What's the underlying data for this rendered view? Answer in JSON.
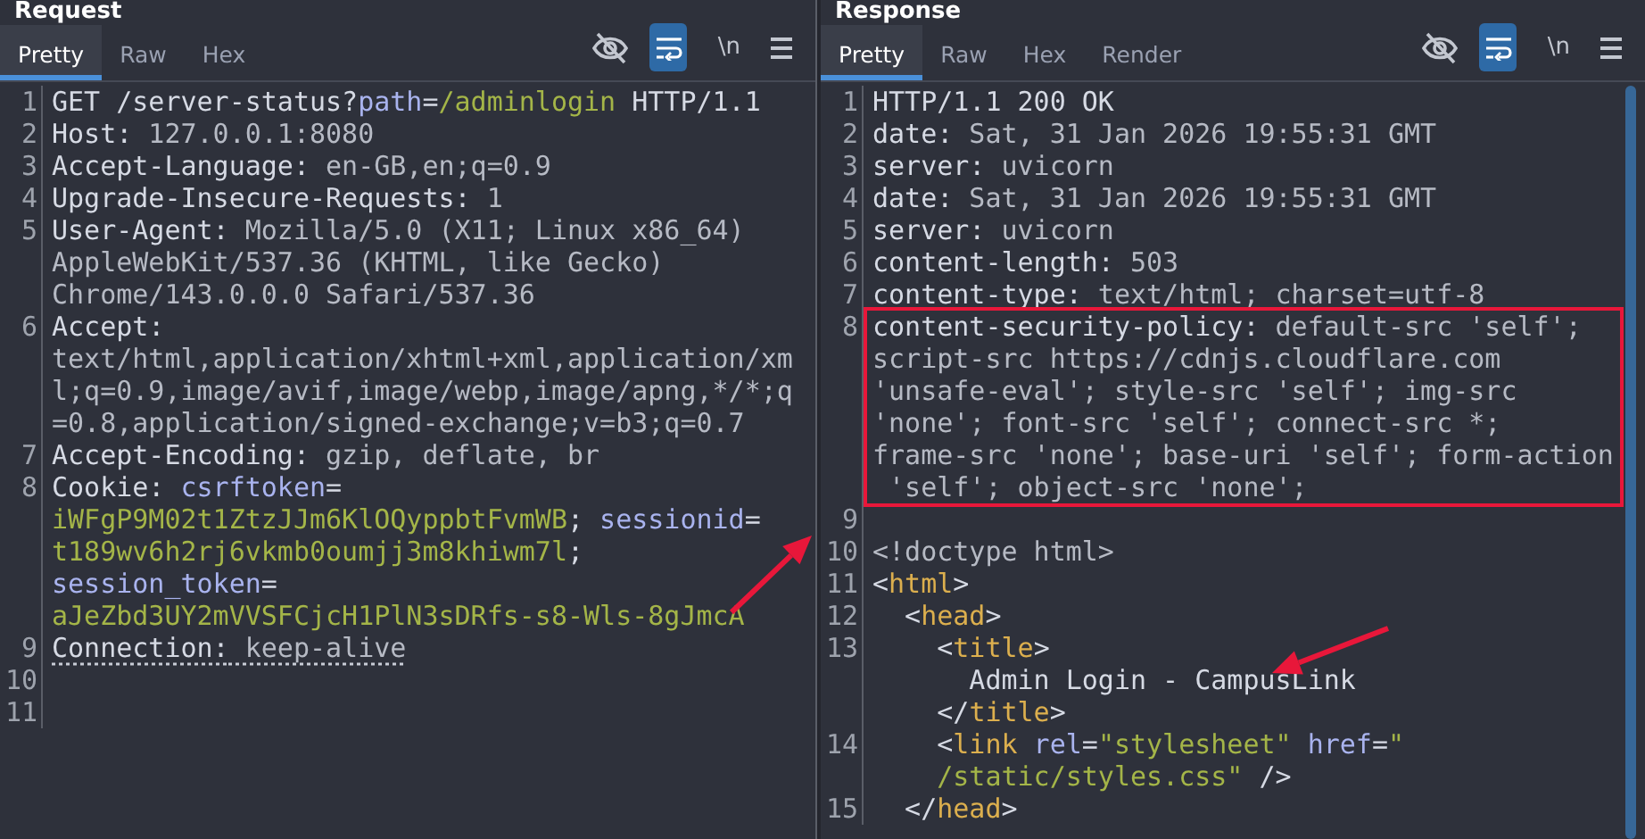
{
  "panels": [
    {
      "title": "Request",
      "tabs": [
        {
          "label": "Pretty",
          "selected": true
        },
        {
          "label": "Raw",
          "selected": false
        },
        {
          "label": "Hex",
          "selected": false
        }
      ],
      "toolbar": [
        {
          "kind": "hide"
        },
        {
          "kind": "wrap",
          "selected": true
        },
        {
          "kind": "newline",
          "label": "\\n"
        },
        {
          "kind": "menu"
        }
      ],
      "lines": [
        {
          "number": "1",
          "rows": [
            {
              "spans": [
                {
                  "kind": "name",
                  "text": "GET /server-status?"
                },
                {
                  "kind": "param",
                  "text": "path"
                },
                {
                  "kind": "name",
                  "text": "="
                },
                {
                  "kind": "green",
                  "text": "/adminlogin"
                },
                {
                  "kind": "name",
                  "text": " HTTP/1.1"
                }
              ]
            }
          ]
        },
        {
          "number": "2",
          "rows": [
            {
              "spans": [
                {
                  "kind": "name",
                  "text": "Host:"
                },
                {
                  "kind": "value",
                  "text": " 127.0.0.1:8080"
                }
              ]
            }
          ]
        },
        {
          "number": "3",
          "rows": [
            {
              "spans": [
                {
                  "kind": "name",
                  "text": "Accept-Language:"
                },
                {
                  "kind": "value",
                  "text": " en-GB,en;q=0.9"
                }
              ]
            }
          ]
        },
        {
          "number": "4",
          "rows": [
            {
              "spans": [
                {
                  "kind": "name",
                  "text": "Upgrade-Insecure-Requests:"
                },
                {
                  "kind": "value",
                  "text": " 1"
                }
              ]
            }
          ]
        },
        {
          "number": "5",
          "rows": [
            {
              "spans": [
                {
                  "kind": "name",
                  "text": "User-Agent:"
                },
                {
                  "kind": "value",
                  "text": " Mozilla/5.0 (X11; Linux x86_64)"
                }
              ]
            },
            {
              "spans": [
                {
                  "kind": "value",
                  "text": "AppleWebKit/537.36 (KHTML, like Gecko)"
                }
              ]
            },
            {
              "spans": [
                {
                  "kind": "value",
                  "text": "Chrome/143.0.0.0 Safari/537.36"
                }
              ]
            }
          ]
        },
        {
          "number": "6",
          "rows": [
            {
              "spans": [
                {
                  "kind": "name",
                  "text": "Accept:"
                }
              ]
            },
            {
              "spans": [
                {
                  "kind": "value",
                  "text": "text/html,application/xhtml+xml,application/xm"
                }
              ]
            },
            {
              "spans": [
                {
                  "kind": "value",
                  "text": "l;q=0.9,image/avif,image/webp,image/apng,*/*;q"
                }
              ]
            },
            {
              "spans": [
                {
                  "kind": "value",
                  "text": "=0.8,application/signed-exchange;v=b3;q=0.7"
                }
              ]
            }
          ]
        },
        {
          "number": "7",
          "rows": [
            {
              "spans": [
                {
                  "kind": "name",
                  "text": "Accept-Encoding:"
                },
                {
                  "kind": "value",
                  "text": " gzip, deflate, br"
                }
              ]
            }
          ]
        },
        {
          "number": "8",
          "rows": [
            {
              "spans": [
                {
                  "kind": "name",
                  "text": "Cookie: "
                },
                {
                  "kind": "param",
                  "text": "csrftoken"
                },
                {
                  "kind": "name",
                  "text": "="
                }
              ]
            },
            {
              "spans": [
                {
                  "kind": "green",
                  "text": "iWFgP9M02t1ZtzJJm6KlOQyppbtFvmWB"
                },
                {
                  "kind": "name",
                  "text": "; "
                },
                {
                  "kind": "param",
                  "text": "sessionid"
                },
                {
                  "kind": "name",
                  "text": "="
                }
              ]
            },
            {
              "spans": [
                {
                  "kind": "green",
                  "text": "t189wv6h2rj6vkmb0oumjj3m8khiwm7l"
                },
                {
                  "kind": "name",
                  "text": ";"
                }
              ]
            },
            {
              "spans": [
                {
                  "kind": "param",
                  "text": "session_token"
                },
                {
                  "kind": "name",
                  "text": "="
                }
              ]
            },
            {
              "spans": [
                {
                  "kind": "green",
                  "text": "aJeZbd3UY2mVVSFCjcH1PlN3sDRfs-s8-Wls-8gJmcA"
                }
              ]
            }
          ]
        },
        {
          "number": "9",
          "underlined": true,
          "rows": [
            {
              "spans": [
                {
                  "kind": "name",
                  "text": "Connection:"
                },
                {
                  "kind": "value",
                  "text": " keep-alive"
                }
              ]
            }
          ]
        },
        {
          "number": "10",
          "rows": [
            {}
          ]
        },
        {
          "number": "11",
          "rows": [
            {}
          ]
        }
      ]
    },
    {
      "title": "Response",
      "tabs": [
        {
          "label": "Pretty",
          "selected": true
        },
        {
          "label": "Raw",
          "selected": false
        },
        {
          "label": "Hex",
          "selected": false
        },
        {
          "label": "Render",
          "selected": false
        }
      ],
      "toolbar": [
        {
          "kind": "hide"
        },
        {
          "kind": "wrap",
          "selected": true
        },
        {
          "kind": "newline",
          "label": "\\n"
        },
        {
          "kind": "menu"
        }
      ],
      "lines": [
        {
          "number": "1",
          "rows": [
            {
              "spans": [
                {
                  "kind": "name",
                  "text": "HTTP/1.1 200 OK"
                }
              ]
            }
          ]
        },
        {
          "number": "2",
          "rows": [
            {
              "spans": [
                {
                  "kind": "name",
                  "text": "date:"
                },
                {
                  "kind": "value",
                  "text": " Sat, 31 Jan 2026 19:55:31 GMT"
                }
              ]
            }
          ]
        },
        {
          "number": "3",
          "rows": [
            {
              "spans": [
                {
                  "kind": "name",
                  "text": "server:"
                },
                {
                  "kind": "value",
                  "text": " uvicorn"
                }
              ]
            }
          ]
        },
        {
          "number": "4",
          "rows": [
            {
              "spans": [
                {
                  "kind": "name",
                  "text": "date:"
                },
                {
                  "kind": "value",
                  "text": " Sat, 31 Jan 2026 19:55:31 GMT"
                }
              ]
            }
          ]
        },
        {
          "number": "5",
          "rows": [
            {
              "spans": [
                {
                  "kind": "name",
                  "text": "server:"
                },
                {
                  "kind": "value",
                  "text": " uvicorn"
                }
              ]
            }
          ]
        },
        {
          "number": "6",
          "rows": [
            {
              "spans": [
                {
                  "kind": "name",
                  "text": "content-length:"
                },
                {
                  "kind": "value",
                  "text": " 503"
                }
              ]
            }
          ]
        },
        {
          "number": "7",
          "rows": [
            {
              "spans": [
                {
                  "kind": "name",
                  "text": "content-type:"
                },
                {
                  "kind": "value",
                  "text": " text/html; charset=utf-8"
                }
              ]
            }
          ]
        },
        {
          "number": "8",
          "rows": [
            {
              "spans": [
                {
                  "kind": "name",
                  "text": "content-security-policy:"
                },
                {
                  "kind": "value",
                  "text": " default-src 'self';"
                }
              ]
            },
            {
              "spans": [
                {
                  "kind": "value",
                  "text": "script-src https://cdnjs.cloudflare.com"
                }
              ]
            },
            {
              "spans": [
                {
                  "kind": "value",
                  "text": "'unsafe-eval'; style-src 'self'; img-src"
                }
              ]
            },
            {
              "spans": [
                {
                  "kind": "value",
                  "text": "'none'; font-src 'self'; connect-src *;"
                }
              ]
            },
            {
              "spans": [
                {
                  "kind": "value",
                  "text": "frame-src 'none'; base-uri 'self'; form-action"
                }
              ]
            },
            {
              "spans": [
                {
                  "kind": "value",
                  "text": " 'self'; object-src 'none';"
                }
              ]
            }
          ]
        },
        {
          "number": "9",
          "rows": [
            {}
          ]
        },
        {
          "number": "10",
          "rows": [
            {
              "spans": [
                {
                  "kind": "value",
                  "text": "<!doctype html>"
                }
              ]
            }
          ]
        },
        {
          "number": "11",
          "rows": [
            {
              "spans": [
                {
                  "kind": "name",
                  "text": "<"
                },
                {
                  "kind": "tag",
                  "text": "html"
                },
                {
                  "kind": "name",
                  "text": ">"
                }
              ]
            }
          ]
        },
        {
          "number": "12",
          "rows": [
            {
              "spans": [
                {
                  "kind": "name",
                  "text": "  <"
                },
                {
                  "kind": "tag",
                  "text": "head"
                },
                {
                  "kind": "name",
                  "text": ">"
                }
              ]
            }
          ]
        },
        {
          "number": "13",
          "rows": [
            {
              "spans": [
                {
                  "kind": "name",
                  "text": "    <"
                },
                {
                  "kind": "tag",
                  "text": "title"
                },
                {
                  "kind": "name",
                  "text": ">"
                }
              ]
            },
            {
              "spans": [
                {
                  "kind": "name",
                  "text": "      Admin Login - CampusLink"
                }
              ]
            },
            {
              "spans": [
                {
                  "kind": "name",
                  "text": "    </"
                },
                {
                  "kind": "tag",
                  "text": "title"
                },
                {
                  "kind": "name",
                  "text": ">"
                }
              ]
            }
          ]
        },
        {
          "number": "14",
          "rows": [
            {
              "spans": [
                {
                  "kind": "name",
                  "text": "    <"
                },
                {
                  "kind": "tag",
                  "text": "link"
                },
                {
                  "kind": "param",
                  "text": " rel"
                },
                {
                  "kind": "name",
                  "text": "="
                },
                {
                  "kind": "green",
                  "text": "\"stylesheet\""
                },
                {
                  "kind": "param",
                  "text": " href"
                },
                {
                  "kind": "name",
                  "text": "="
                },
                {
                  "kind": "green",
                  "text": "\""
                }
              ]
            },
            {
              "spans": [
                {
                  "kind": "green",
                  "text": "    /static/styles.css\""
                },
                {
                  "kind": "name",
                  "text": " />"
                }
              ]
            }
          ]
        },
        {
          "number": "15",
          "rows": [
            {
              "spans": [
                {
                  "kind": "name",
                  "text": "  </"
                },
                {
                  "kind": "tag",
                  "text": "head"
                },
                {
                  "kind": "name",
                  "text": ">"
                }
              ]
            }
          ]
        }
      ]
    }
  ],
  "annotations": [
    {
      "kind": "box"
    },
    {
      "kind": "arrow"
    },
    {
      "kind": "arrow"
    }
  ]
}
